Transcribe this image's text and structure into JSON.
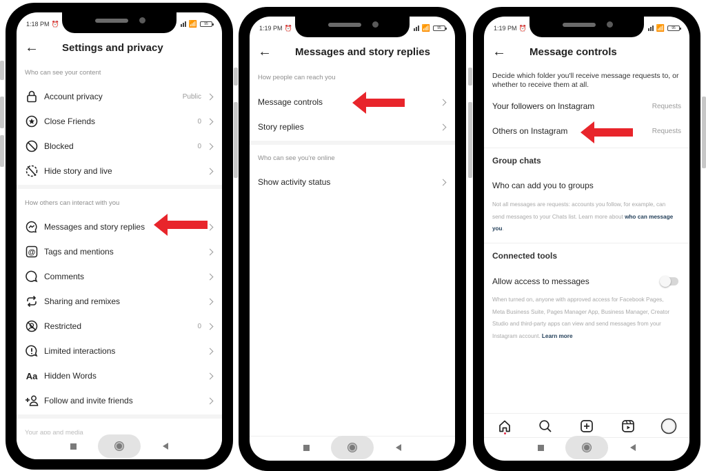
{
  "phones": [
    {
      "status": {
        "time": "1:18 PM",
        "battery": "95"
      },
      "title": "Settings and privacy",
      "sections": [
        {
          "label": "Who can see your content",
          "items": [
            {
              "icon": "lock-icon",
              "label": "Account privacy",
              "value": "Public"
            },
            {
              "icon": "close-friends-star-icon",
              "label": "Close Friends",
              "value": "0"
            },
            {
              "icon": "blocked-icon",
              "label": "Blocked",
              "value": "0"
            },
            {
              "icon": "hide-story-icon",
              "label": "Hide story and live",
              "value": ""
            }
          ]
        },
        {
          "label": "How others can interact with you",
          "items": [
            {
              "icon": "messenger-icon",
              "label": "Messages and story replies",
              "value": ""
            },
            {
              "icon": "at-mention-icon",
              "label": "Tags and mentions",
              "value": ""
            },
            {
              "icon": "comment-bubble-icon",
              "label": "Comments",
              "value": ""
            },
            {
              "icon": "remix-icon",
              "label": "Sharing and remixes",
              "value": ""
            },
            {
              "icon": "restricted-icon",
              "label": "Restricted",
              "value": "0"
            },
            {
              "icon": "limited-interactions-icon",
              "label": "Limited interactions",
              "value": ""
            },
            {
              "icon": "hidden-words-icon",
              "label": "Hidden Words",
              "value": ""
            },
            {
              "icon": "add-person-icon",
              "label": "Follow and invite friends",
              "value": ""
            }
          ]
        },
        {
          "label": "Your app and media",
          "items": []
        }
      ],
      "hidden_words_glyph": "Aa"
    },
    {
      "status": {
        "time": "1:19 PM",
        "battery": "95"
      },
      "title": "Messages and story replies",
      "sections": [
        {
          "label": "How people can reach you",
          "items": [
            {
              "label": "Message controls"
            },
            {
              "label": "Story replies"
            }
          ]
        },
        {
          "label": "Who can see you're online",
          "items": [
            {
              "label": "Show activity status"
            }
          ]
        }
      ]
    },
    {
      "status": {
        "time": "1:19 PM",
        "battery": "95"
      },
      "title": "Message controls",
      "description": "Decide which folder you'll receive message requests to, or whether to receive them at all.",
      "requests_rows": [
        {
          "label": "Your followers on Instagram",
          "value": "Requests"
        },
        {
          "label": "Others on Instagram",
          "value": "Requests"
        }
      ],
      "group_chats": {
        "heading": "Group chats",
        "row": "Who can add you to groups",
        "note": "Not all messages are requests: accounts you follow, for example, can send messages to your Chats list. Learn more about ",
        "note_link": "who can message you",
        "note_end": "."
      },
      "connected_tools": {
        "heading": "Connected tools",
        "row": "Allow access to messages",
        "toggle_on": false,
        "note": "When turned on, anyone with approved access for Facebook Pages, Meta Business Suite, Pages Manager App, Business Manager, Creator Studio and third-party apps can view and send messages from your Instagram account. ",
        "note_link": "Learn more"
      },
      "tabbar": [
        "home-icon",
        "search-icon",
        "create-post-icon",
        "reels-icon",
        "profile-avatar"
      ]
    }
  ],
  "annotation": {
    "arrow_color": "#e8252b"
  }
}
